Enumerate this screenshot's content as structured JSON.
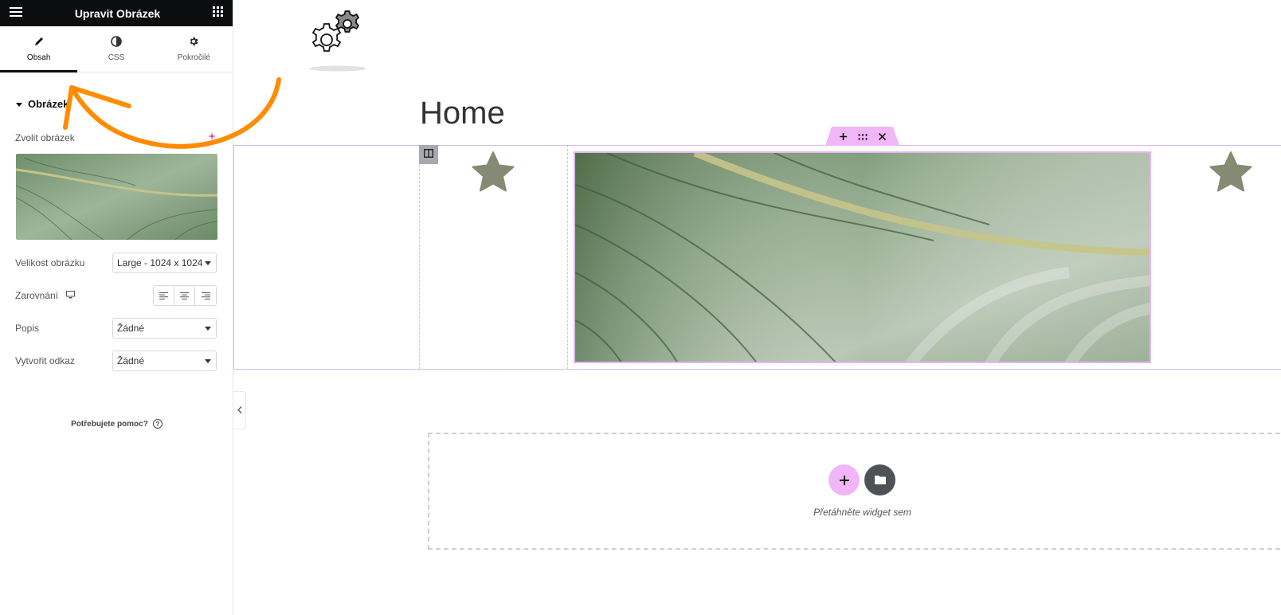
{
  "panel": {
    "title": "Upravit Obrázek",
    "tabs": [
      {
        "label": "Obsah",
        "icon": "pencil-icon",
        "active": true
      },
      {
        "label": "CSS",
        "icon": "contrast-icon",
        "active": false
      },
      {
        "label": "Pokročilé",
        "icon": "gear-icon",
        "active": false
      }
    ],
    "section_title": "Obrázek",
    "choose_image_label": "Zvolit obrázek",
    "image_size": {
      "label": "Velikost obrázku",
      "value": "Large - 1024 x 1024"
    },
    "alignment": {
      "label": "Zarovnání"
    },
    "caption": {
      "label": "Popis",
      "value": "Žádné"
    },
    "link": {
      "label": "Vytvořit odkaz",
      "value": "Žádné"
    },
    "help_text": "Potřebujete pomoc?"
  },
  "canvas": {
    "heading": "Home",
    "drop_text": "Přetáhněte widget sem"
  },
  "colors": {
    "accent_pink": "#f0b6f8",
    "annotation_orange": "#ff8c00",
    "topbar": "#0c0d0e",
    "star": "#858a72"
  }
}
